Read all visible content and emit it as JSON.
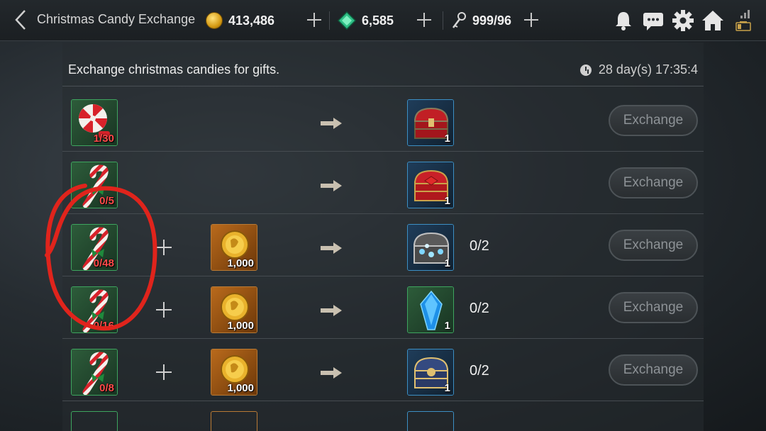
{
  "header": {
    "title": "Christmas Candy Exchange",
    "gold": "413,486",
    "gems": "6,585",
    "keys": "999/96"
  },
  "panel": {
    "subtitle": "Exchange christmas candies for gifts.",
    "timer": "28 day(s) 17:35:4"
  },
  "rows": [
    {
      "cost1_count": "1/30",
      "cost2_count": "",
      "reward_count": "1",
      "limit": "",
      "button": "Exchange"
    },
    {
      "cost1_count": "0/5",
      "cost2_count": "",
      "reward_count": "1",
      "limit": "",
      "button": "Exchange"
    },
    {
      "cost1_count": "0/48",
      "cost2_count": "1,000",
      "reward_count": "1",
      "limit": "0/2",
      "button": "Exchange"
    },
    {
      "cost1_count": "0/16",
      "cost2_count": "1,000",
      "reward_count": "1",
      "limit": "0/2",
      "button": "Exchange"
    },
    {
      "cost1_count": "0/8",
      "cost2_count": "1,000",
      "reward_count": "1",
      "limit": "0/2",
      "button": "Exchange"
    }
  ],
  "colors": {
    "candy_count": "#ff4a4a",
    "annotation_circle": "#e0241c",
    "button_text": "#8d9296"
  },
  "icons": {
    "header": [
      "back-arrow-icon",
      "gold-coin-icon",
      "gem-icon",
      "key-icon",
      "bell-icon",
      "chat-icon",
      "gear-icon",
      "home-icon",
      "signal-battery-icon"
    ],
    "rows": [
      "peppermint-candy-icon",
      "candy-cane-icon",
      "gold-coin-pile-icon",
      "red-chest-icon",
      "silver-chest-icon",
      "blue-crystal-icon",
      "gold-chest-icon"
    ]
  }
}
